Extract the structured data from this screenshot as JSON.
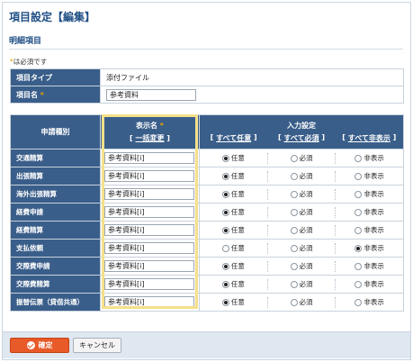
{
  "page": {
    "title": "項目設定【編集】",
    "section_title": "明細項目",
    "required_note": "は必須です",
    "required_mark": "*"
  },
  "info": {
    "type_label": "項目タイプ",
    "type_value": "添付ファイル",
    "name_label": "項目名",
    "name_value": "参考資料"
  },
  "table": {
    "col_type": "申請種別",
    "col_display_name": "表示名",
    "bulk_change": "一括変更",
    "col_input": "入力設定",
    "all_optional": "すべて任意",
    "all_required": "すべて必須",
    "all_hidden": "すべて非表示",
    "opt_optional": "任意",
    "opt_required": "必須",
    "opt_hidden": "非表示",
    "rows": [
      {
        "type": "交通精算",
        "name": "参考資料[i]",
        "selected": "optional"
      },
      {
        "type": "出張精算",
        "name": "参考資料[i]",
        "selected": "optional"
      },
      {
        "type": "海外出張精算",
        "name": "参考資料[i]",
        "selected": "optional"
      },
      {
        "type": "経費申請",
        "name": "参考資料[i]",
        "selected": "optional"
      },
      {
        "type": "経費精算",
        "name": "参考資料[i]",
        "selected": "optional"
      },
      {
        "type": "支払依頼",
        "name": "参考資料[i]",
        "selected": "hidden"
      },
      {
        "type": "交際費申請",
        "name": "参考資料[i]",
        "selected": "optional"
      },
      {
        "type": "交際費精算",
        "name": "参考資料[i]",
        "selected": "optional"
      },
      {
        "type": "振替伝票（貸借共通）",
        "name": "参考資料[i]",
        "selected": "optional"
      }
    ]
  },
  "buttons": {
    "ok": "確定",
    "cancel": "キャンセル"
  },
  "colors": {
    "header_bg": "#3a5e8a",
    "title": "#1f4f85",
    "required_star": "#e8a000",
    "ok_button": "#e85a28",
    "highlight": "#f4e08a"
  }
}
